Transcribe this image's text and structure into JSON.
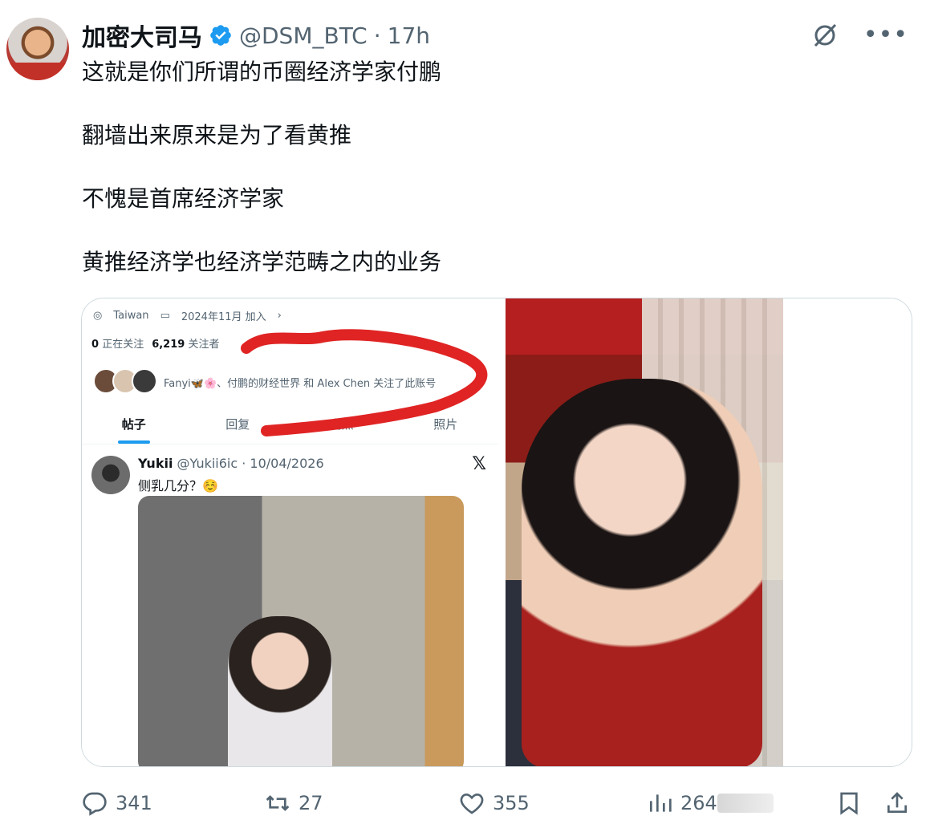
{
  "author": {
    "display_name": "加密大司马",
    "handle": "@DSM_BTC",
    "separator": "·",
    "time": "17h"
  },
  "tweet": {
    "lines": [
      "这就是你们所谓的币圈经济学家付鹏",
      "翻墙出来原来是为了看黄推",
      "不愧是首席经济学家",
      "黄推经济学也经济学范畴之内的业务"
    ]
  },
  "embedded_profile": {
    "location": "Taiwan",
    "joined": "2024年11月 加入",
    "following_count": "0",
    "following_label": "正在关注",
    "followers_count": "6,219",
    "followers_label": "关注者",
    "followed_by": "Fanyi🦋🌸、付鹏的财经世界 和 Alex Chen 关注了此账号",
    "tabs": [
      "帖子",
      "回复",
      "亮点",
      "照片"
    ]
  },
  "embedded_post": {
    "name": "Yukii",
    "handle_date": "@Yukii6ic · 10/04/2026",
    "text": "侧乳几分？☺️",
    "x_logo": "𝕏"
  },
  "actions": {
    "replies": "341",
    "retweets": "27",
    "likes": "355",
    "views": "264"
  },
  "colors": {
    "accent": "#1d9bf0",
    "secondary_text": "#536471",
    "scribble": "#e02424"
  },
  "icons": [
    "verified-badge-icon",
    "grok-icon",
    "more-icon",
    "reply-icon",
    "retweet-icon",
    "like-icon",
    "views-icon",
    "bookmark-icon",
    "share-icon",
    "location-icon",
    "calendar-icon"
  ]
}
